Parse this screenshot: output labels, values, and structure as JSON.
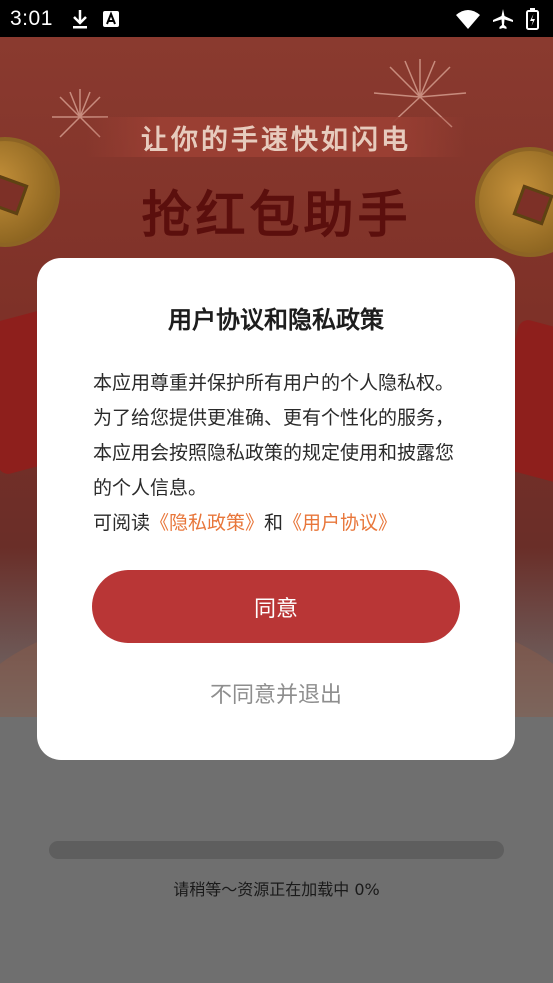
{
  "status_bar": {
    "time": "3:01",
    "icons": [
      "download-icon",
      "font-icon",
      "wifi-icon",
      "airplane-mode-icon",
      "battery-charging-icon"
    ]
  },
  "splash": {
    "slogan": "让你的手速快如闪电",
    "app_title": "抢红包助手"
  },
  "dialog": {
    "title": "用户协议和隐私政策",
    "body": "本应用尊重并保护所有用户的个人隐私权。为了给您提供更准确、更有个性化的服务，本应用会按照隐私政策的规定使用和披露您的个人信息。",
    "links_prefix": "可阅读",
    "privacy_link": "《隐私政策》",
    "links_and": "和",
    "user_agreement_link": "《用户协议》",
    "agree_label": "同意",
    "disagree_label": "不同意并退出"
  },
  "loading": {
    "text": "请稍等～资源正在加载中 0%",
    "progress": 0
  },
  "colors": {
    "accent_button": "#b93636",
    "link": "#e8763a"
  }
}
